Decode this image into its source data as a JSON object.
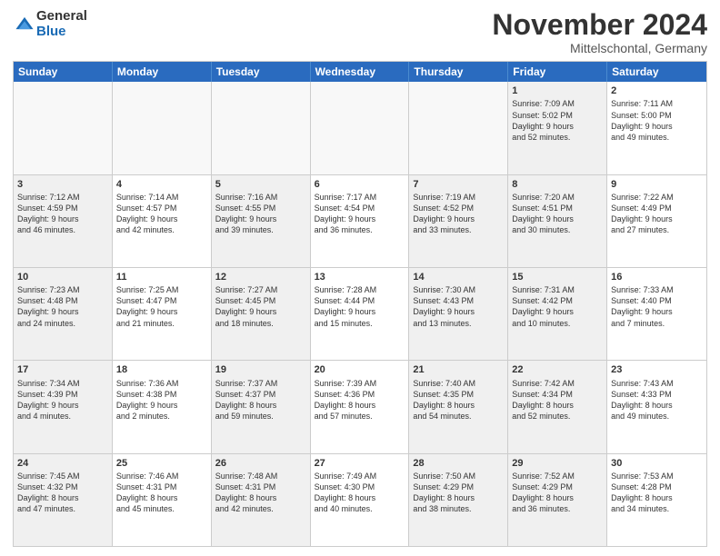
{
  "logo": {
    "general": "General",
    "blue": "Blue"
  },
  "title": "November 2024",
  "location": "Mittelschontal, Germany",
  "header_days": [
    "Sunday",
    "Monday",
    "Tuesday",
    "Wednesday",
    "Thursday",
    "Friday",
    "Saturday"
  ],
  "weeks": [
    [
      {
        "day": "",
        "info": "",
        "empty": true
      },
      {
        "day": "",
        "info": "",
        "empty": true
      },
      {
        "day": "",
        "info": "",
        "empty": true
      },
      {
        "day": "",
        "info": "",
        "empty": true
      },
      {
        "day": "",
        "info": "",
        "empty": true
      },
      {
        "day": "1",
        "info": "Sunrise: 7:09 AM\nSunset: 5:02 PM\nDaylight: 9 hours\nand 52 minutes.",
        "shaded": true
      },
      {
        "day": "2",
        "info": "Sunrise: 7:11 AM\nSunset: 5:00 PM\nDaylight: 9 hours\nand 49 minutes."
      }
    ],
    [
      {
        "day": "3",
        "info": "Sunrise: 7:12 AM\nSunset: 4:59 PM\nDaylight: 9 hours\nand 46 minutes.",
        "shaded": true
      },
      {
        "day": "4",
        "info": "Sunrise: 7:14 AM\nSunset: 4:57 PM\nDaylight: 9 hours\nand 42 minutes."
      },
      {
        "day": "5",
        "info": "Sunrise: 7:16 AM\nSunset: 4:55 PM\nDaylight: 9 hours\nand 39 minutes.",
        "shaded": true
      },
      {
        "day": "6",
        "info": "Sunrise: 7:17 AM\nSunset: 4:54 PM\nDaylight: 9 hours\nand 36 minutes."
      },
      {
        "day": "7",
        "info": "Sunrise: 7:19 AM\nSunset: 4:52 PM\nDaylight: 9 hours\nand 33 minutes.",
        "shaded": true
      },
      {
        "day": "8",
        "info": "Sunrise: 7:20 AM\nSunset: 4:51 PM\nDaylight: 9 hours\nand 30 minutes.",
        "shaded": true
      },
      {
        "day": "9",
        "info": "Sunrise: 7:22 AM\nSunset: 4:49 PM\nDaylight: 9 hours\nand 27 minutes."
      }
    ],
    [
      {
        "day": "10",
        "info": "Sunrise: 7:23 AM\nSunset: 4:48 PM\nDaylight: 9 hours\nand 24 minutes.",
        "shaded": true
      },
      {
        "day": "11",
        "info": "Sunrise: 7:25 AM\nSunset: 4:47 PM\nDaylight: 9 hours\nand 21 minutes."
      },
      {
        "day": "12",
        "info": "Sunrise: 7:27 AM\nSunset: 4:45 PM\nDaylight: 9 hours\nand 18 minutes.",
        "shaded": true
      },
      {
        "day": "13",
        "info": "Sunrise: 7:28 AM\nSunset: 4:44 PM\nDaylight: 9 hours\nand 15 minutes."
      },
      {
        "day": "14",
        "info": "Sunrise: 7:30 AM\nSunset: 4:43 PM\nDaylight: 9 hours\nand 13 minutes.",
        "shaded": true
      },
      {
        "day": "15",
        "info": "Sunrise: 7:31 AM\nSunset: 4:42 PM\nDaylight: 9 hours\nand 10 minutes.",
        "shaded": true
      },
      {
        "day": "16",
        "info": "Sunrise: 7:33 AM\nSunset: 4:40 PM\nDaylight: 9 hours\nand 7 minutes."
      }
    ],
    [
      {
        "day": "17",
        "info": "Sunrise: 7:34 AM\nSunset: 4:39 PM\nDaylight: 9 hours\nand 4 minutes.",
        "shaded": true
      },
      {
        "day": "18",
        "info": "Sunrise: 7:36 AM\nSunset: 4:38 PM\nDaylight: 9 hours\nand 2 minutes."
      },
      {
        "day": "19",
        "info": "Sunrise: 7:37 AM\nSunset: 4:37 PM\nDaylight: 8 hours\nand 59 minutes.",
        "shaded": true
      },
      {
        "day": "20",
        "info": "Sunrise: 7:39 AM\nSunset: 4:36 PM\nDaylight: 8 hours\nand 57 minutes."
      },
      {
        "day": "21",
        "info": "Sunrise: 7:40 AM\nSunset: 4:35 PM\nDaylight: 8 hours\nand 54 minutes.",
        "shaded": true
      },
      {
        "day": "22",
        "info": "Sunrise: 7:42 AM\nSunset: 4:34 PM\nDaylight: 8 hours\nand 52 minutes.",
        "shaded": true
      },
      {
        "day": "23",
        "info": "Sunrise: 7:43 AM\nSunset: 4:33 PM\nDaylight: 8 hours\nand 49 minutes."
      }
    ],
    [
      {
        "day": "24",
        "info": "Sunrise: 7:45 AM\nSunset: 4:32 PM\nDaylight: 8 hours\nand 47 minutes.",
        "shaded": true
      },
      {
        "day": "25",
        "info": "Sunrise: 7:46 AM\nSunset: 4:31 PM\nDaylight: 8 hours\nand 45 minutes."
      },
      {
        "day": "26",
        "info": "Sunrise: 7:48 AM\nSunset: 4:31 PM\nDaylight: 8 hours\nand 42 minutes.",
        "shaded": true
      },
      {
        "day": "27",
        "info": "Sunrise: 7:49 AM\nSunset: 4:30 PM\nDaylight: 8 hours\nand 40 minutes."
      },
      {
        "day": "28",
        "info": "Sunrise: 7:50 AM\nSunset: 4:29 PM\nDaylight: 8 hours\nand 38 minutes.",
        "shaded": true
      },
      {
        "day": "29",
        "info": "Sunrise: 7:52 AM\nSunset: 4:29 PM\nDaylight: 8 hours\nand 36 minutes.",
        "shaded": true
      },
      {
        "day": "30",
        "info": "Sunrise: 7:53 AM\nSunset: 4:28 PM\nDaylight: 8 hours\nand 34 minutes."
      }
    ]
  ]
}
